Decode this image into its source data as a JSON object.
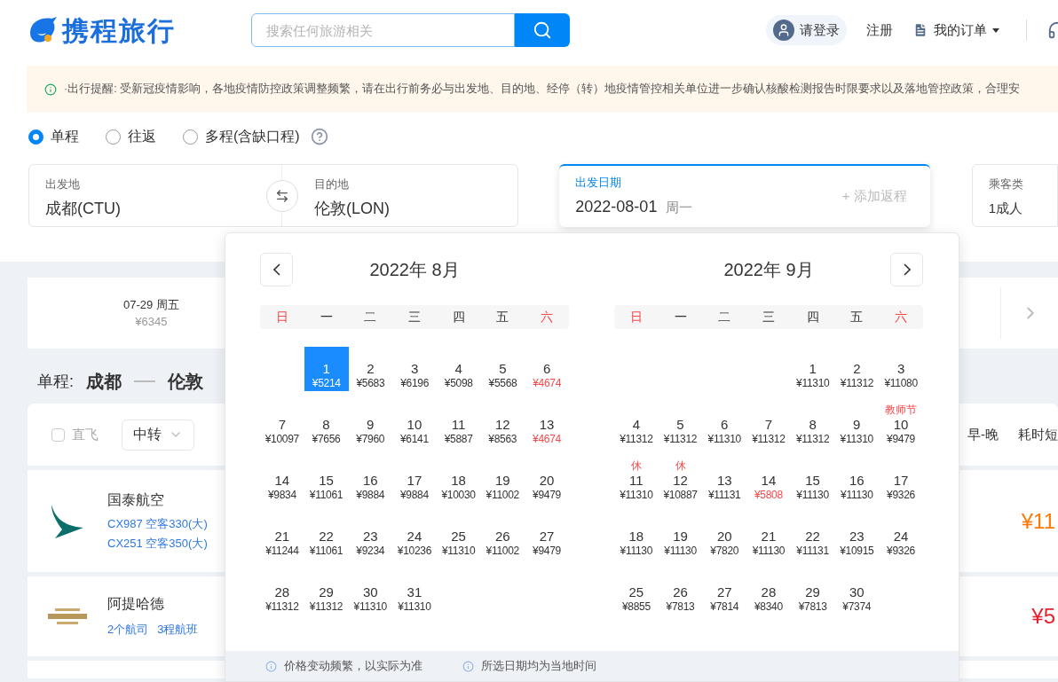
{
  "header": {
    "logo": "携程旅行",
    "search": {
      "placeholder": "搜索任何旅游相关"
    },
    "login": "请登录",
    "register": "注册",
    "orders": "我的订单"
  },
  "notice": "·出行提醒: 受新冠疫情影响，各地疫情防控政策调整频繁，请在出行前务必与出发地、目的地、经停（转）地疫情管控相关单位进一步确认核酸检测报告时限要求以及落地管控政策，合理安",
  "trip_types": [
    {
      "label": "单程",
      "selected": true
    },
    {
      "label": "往返",
      "selected": false
    },
    {
      "label": "多程(含缺口程)",
      "selected": false
    }
  ],
  "search_form": {
    "from": {
      "label": "出发地",
      "value": "成都(CTU)"
    },
    "to": {
      "label": "目的地",
      "value": "伦敦(LON)"
    },
    "date": {
      "label": "出发日期",
      "value": "2022-08-01",
      "weekday": "周一",
      "add_return": "+ 添加返程"
    },
    "passenger": {
      "label": "乘客类",
      "value": "1成人"
    }
  },
  "date_strip": {
    "date": "07-29 周五",
    "price": "¥6345"
  },
  "route": {
    "trip": "单程:",
    "from": "成都",
    "to": "伦敦"
  },
  "filters": {
    "direct": {
      "label": "直飞",
      "checked": false
    },
    "transfer": "中转",
    "sort": [
      "早-晚",
      "耗时短"
    ]
  },
  "flights": [
    {
      "airline": "国泰航空",
      "lines": [
        "CX987 空客330(大)",
        "CX251 空客350(大)"
      ],
      "price": "¥11",
      "color": "#ff7700"
    },
    {
      "airline": "阿提哈德",
      "lines": [
        "2个航司",
        "3程航班"
      ],
      "price": "¥5",
      "color": "#e8202a"
    }
  ],
  "calendar": {
    "months": [
      {
        "title": "2022年 8月",
        "weekdays": [
          {
            "label": "日",
            "weekend": true
          },
          {
            "label": "一",
            "weekend": false
          },
          {
            "label": "二",
            "weekend": false
          },
          {
            "label": "三",
            "weekend": false
          },
          {
            "label": "四",
            "weekend": false
          },
          {
            "label": "五",
            "weekend": false
          },
          {
            "label": "六",
            "weekend": true
          }
        ],
        "weeks": [
          [
            {
              "day": "1",
              "price": "¥5214",
              "selected": true,
              "low": false
            },
            {
              "day": "2",
              "price": "¥5683",
              "selected": false,
              "low": false
            },
            {
              "day": "3",
              "price": "¥6196",
              "selected": false,
              "low": false
            },
            {
              "day": "4",
              "price": "¥5098",
              "selected": false,
              "low": false
            },
            {
              "day": "5",
              "price": "¥5568",
              "selected": false,
              "low": false
            },
            {
              "day": "6",
              "price": "¥4674",
              "selected": false,
              "low": true
            }
          ],
          [
            {
              "day": "7",
              "price": "¥10097",
              "selected": false,
              "low": false
            },
            {
              "day": "8",
              "price": "¥7656",
              "selected": false,
              "low": false
            },
            {
              "day": "9",
              "price": "¥7960",
              "selected": false,
              "low": false
            },
            {
              "day": "10",
              "price": "¥6141",
              "selected": false,
              "low": false
            },
            {
              "day": "11",
              "price": "¥5887",
              "selected": false,
              "low": false
            },
            {
              "day": "12",
              "price": "¥8563",
              "selected": false,
              "low": false
            },
            {
              "day": "13",
              "price": "¥4674",
              "selected": false,
              "low": true
            }
          ],
          [
            {
              "day": "14",
              "price": "¥9834",
              "selected": false,
              "low": false
            },
            {
              "day": "15",
              "price": "¥11061",
              "selected": false,
              "low": false
            },
            {
              "day": "16",
              "price": "¥9884",
              "selected": false,
              "low": false
            },
            {
              "day": "17",
              "price": "¥9884",
              "selected": false,
              "low": false
            },
            {
              "day": "18",
              "price": "¥10030",
              "selected": false,
              "low": false
            },
            {
              "day": "19",
              "price": "¥11002",
              "selected": false,
              "low": false
            },
            {
              "day": "20",
              "price": "¥9479",
              "selected": false,
              "low": false
            }
          ],
          [
            {
              "day": "21",
              "price": "¥11244",
              "selected": false,
              "low": false
            },
            {
              "day": "22",
              "price": "¥11061",
              "selected": false,
              "low": false
            },
            {
              "day": "23",
              "price": "¥9234",
              "selected": false,
              "low": false
            },
            {
              "day": "24",
              "price": "¥10236",
              "selected": false,
              "low": false
            },
            {
              "day": "25",
              "price": "¥11310",
              "selected": false,
              "low": false
            },
            {
              "day": "26",
              "price": "¥11002",
              "selected": false,
              "low": false
            },
            {
              "day": "27",
              "price": "¥9479",
              "selected": false,
              "low": false
            }
          ],
          [
            {
              "day": "28",
              "price": "¥11312",
              "selected": false,
              "low": false
            },
            {
              "day": "29",
              "price": "¥11312",
              "selected": false,
              "low": false
            },
            {
              "day": "30",
              "price": "¥11310",
              "selected": false,
              "low": false
            },
            {
              "day": "31",
              "price": "¥11310",
              "selected": false,
              "low": false
            }
          ]
        ]
      },
      {
        "title": "2022年 9月",
        "weekdays": [
          {
            "label": "日",
            "weekend": true
          },
          {
            "label": "一",
            "weekend": false
          },
          {
            "label": "二",
            "weekend": false
          },
          {
            "label": "三",
            "weekend": false
          },
          {
            "label": "四",
            "weekend": false
          },
          {
            "label": "五",
            "weekend": false
          },
          {
            "label": "六",
            "weekend": true
          }
        ],
        "weeks": [
          [
            {
              "day": "1",
              "price": "¥11310",
              "selected": false,
              "low": false
            },
            {
              "day": "2",
              "price": "¥11312",
              "selected": false,
              "low": false
            },
            {
              "day": "3",
              "price": "¥11080",
              "selected": false,
              "low": false
            }
          ],
          [
            {
              "day": "4",
              "price": "¥11312",
              "selected": false,
              "low": false
            },
            {
              "day": "5",
              "price": "¥11312",
              "selected": false,
              "low": false
            },
            {
              "day": "6",
              "price": "¥11310",
              "selected": false,
              "low": false
            },
            {
              "day": "7",
              "price": "¥11312",
              "selected": false,
              "low": false
            },
            {
              "day": "8",
              "price": "¥11312",
              "selected": false,
              "low": false
            },
            {
              "day": "9",
              "price": "¥11310",
              "selected": false,
              "low": false
            },
            {
              "day": "10",
              "price": "¥9479",
              "selected": false,
              "low": false,
              "note": "教师节"
            }
          ],
          [
            {
              "day": "11",
              "price": "¥11310",
              "selected": false,
              "low": false,
              "note": "休"
            },
            {
              "day": "12",
              "price": "¥10887",
              "selected": false,
              "low": false,
              "note": "休"
            },
            {
              "day": "13",
              "price": "¥11131",
              "selected": false,
              "low": false
            },
            {
              "day": "14",
              "price": "¥5808",
              "selected": false,
              "low": true
            },
            {
              "day": "15",
              "price": "¥11130",
              "selected": false,
              "low": false
            },
            {
              "day": "16",
              "price": "¥11130",
              "selected": false,
              "low": false
            },
            {
              "day": "17",
              "price": "¥9326",
              "selected": false,
              "low": false
            }
          ],
          [
            {
              "day": "18",
              "price": "¥11130",
              "selected": false,
              "low": false
            },
            {
              "day": "19",
              "price": "¥11130",
              "selected": false,
              "low": false
            },
            {
              "day": "20",
              "price": "¥7820",
              "selected": false,
              "low": false
            },
            {
              "day": "21",
              "price": "¥11130",
              "selected": false,
              "low": false
            },
            {
              "day": "22",
              "price": "¥11131",
              "selected": false,
              "low": false
            },
            {
              "day": "23",
              "price": "¥10915",
              "selected": false,
              "low": false
            },
            {
              "day": "24",
              "price": "¥9326",
              "selected": false,
              "low": false
            }
          ],
          [
            {
              "day": "25",
              "price": "¥8855",
              "selected": false,
              "low": false
            },
            {
              "day": "26",
              "price": "¥7813",
              "selected": false,
              "low": false
            },
            {
              "day": "27",
              "price": "¥7814",
              "selected": false,
              "low": false
            },
            {
              "day": "28",
              "price": "¥8340",
              "selected": false,
              "low": false
            },
            {
              "day": "29",
              "price": "¥7813",
              "selected": false,
              "low": false
            },
            {
              "day": "30",
              "price": "¥7374",
              "selected": false,
              "low": false
            }
          ]
        ]
      }
    ],
    "footer_notes": [
      "价格变动频繁，以实际为准",
      "所选日期均为当地时间"
    ]
  }
}
